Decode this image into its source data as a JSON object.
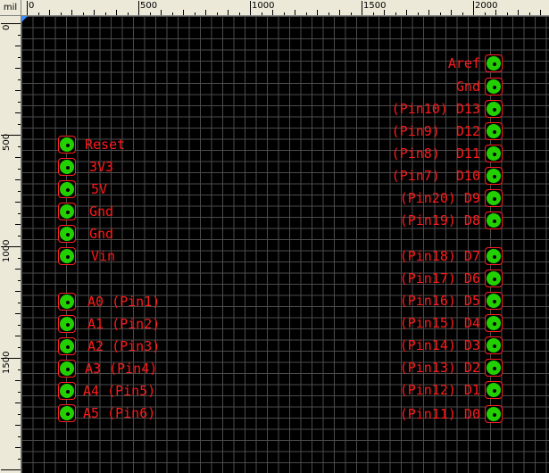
{
  "ruler": {
    "unit": "mil",
    "x_labels": [
      "0",
      "500",
      "1000",
      "1500",
      "2000"
    ],
    "y_labels": [
      "0",
      "500",
      "1000",
      "1500"
    ]
  },
  "colors": {
    "canvas": "#000000",
    "grid": "#4b4b4b",
    "pad_copper": "#22d000",
    "pad_outline": "#ff2020",
    "label_text": "#ff1a1a"
  },
  "left_header": {
    "pins": [
      {
        "label": "Reset"
      },
      {
        "label": "3V3"
      },
      {
        "label": "5V"
      },
      {
        "label": "Gnd"
      },
      {
        "label": "Gnd"
      },
      {
        "label": "Vin"
      },
      {
        "label": "A0 (Pin1)"
      },
      {
        "label": "A1 (Pin2)"
      },
      {
        "label": "A2 (Pin3)"
      },
      {
        "label": "A3 (Pin4)"
      },
      {
        "label": "A4 (Pin5)"
      },
      {
        "label": "A5 (Pin6)"
      }
    ]
  },
  "right_header": {
    "pins": [
      {
        "label": "Aref"
      },
      {
        "label": "Gnd"
      },
      {
        "label": "(Pin10) D13"
      },
      {
        "label": "(Pin9)  D12"
      },
      {
        "label": "(Pin8)  D11"
      },
      {
        "label": "(Pin7)  D10"
      },
      {
        "label": "(Pin20) D9"
      },
      {
        "label": "(Pin19) D8"
      },
      {
        "label": "(Pin18) D7"
      },
      {
        "label": "(Pin17) D6"
      },
      {
        "label": "(Pin16) D5"
      },
      {
        "label": "(Pin15) D4"
      },
      {
        "label": "(Pin14) D3"
      },
      {
        "label": "(Pin13) D2"
      },
      {
        "label": "(Pin12) D1"
      },
      {
        "label": "(Pin11) D0"
      }
    ]
  }
}
